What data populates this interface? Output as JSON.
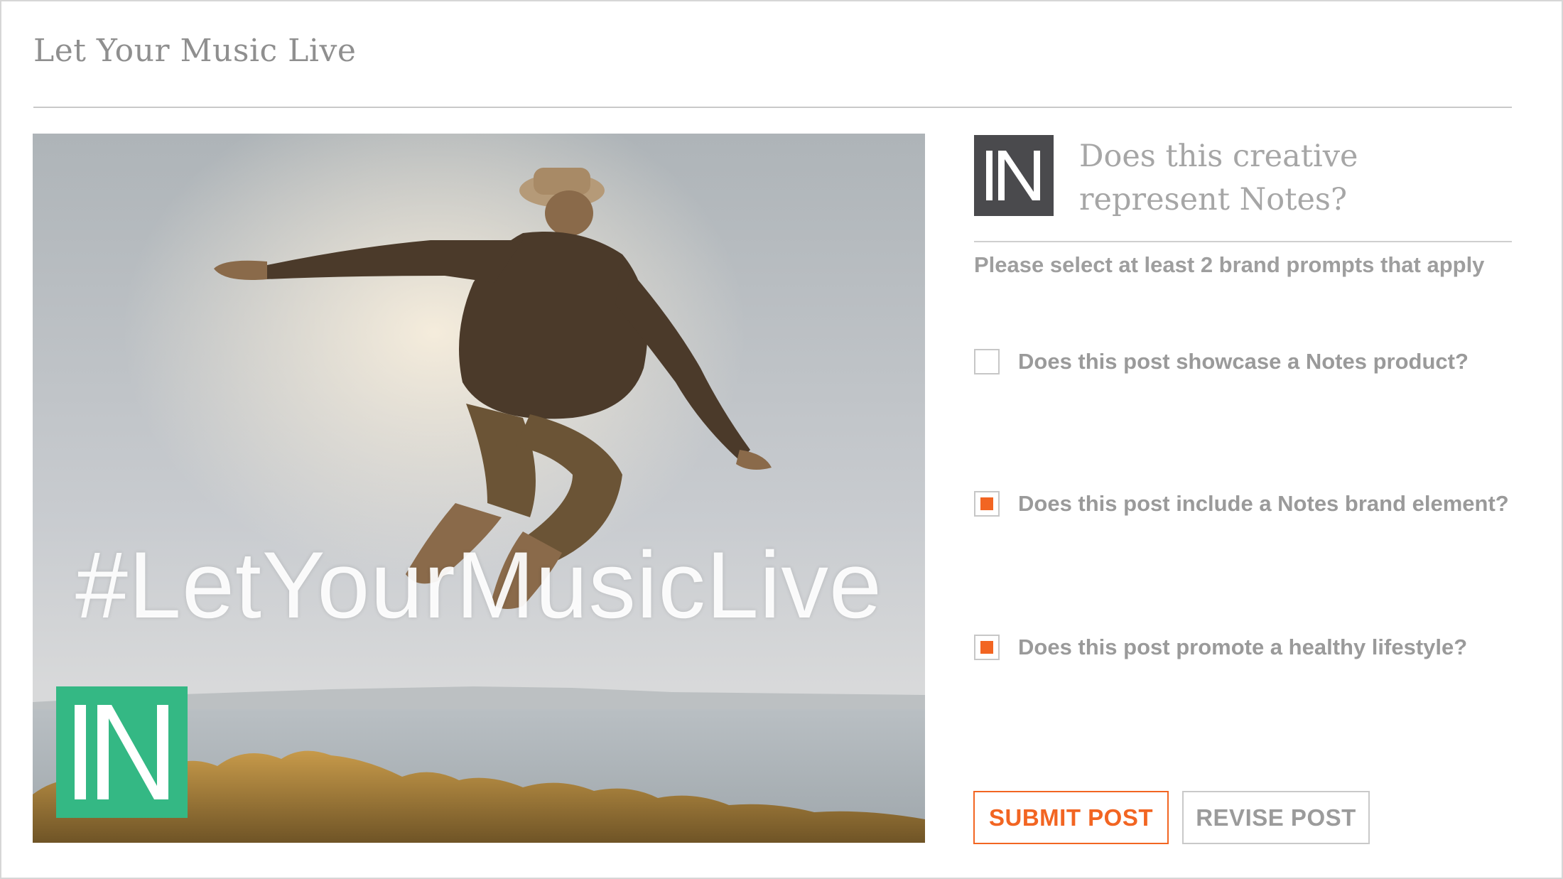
{
  "page": {
    "title": "Let Your Music Live"
  },
  "creative": {
    "hashtag": "#LetYourMusicLive",
    "logo_icon": "notes-n-logo",
    "logo_color": "#34b884"
  },
  "review_panel": {
    "brand_icon": "notes-n-logo",
    "brand_tile_color": "#4a4a4d",
    "question_line1": "Does this creative",
    "question_line2": "represent Notes?",
    "instructions": "Please select at least 2 brand prompts that apply",
    "options": [
      {
        "label": "Does this post showcase a Notes product?",
        "checked": false
      },
      {
        "label": "Does this post include a Notes brand element?",
        "checked": true
      },
      {
        "label": "Does this post promote a healthy lifestyle?",
        "checked": true
      }
    ],
    "submit_label": "SUBMIT POST",
    "revise_label": "REVISE POST"
  },
  "colors": {
    "accent": "#f26522",
    "brand_green": "#34b884",
    "text_muted": "#9a9a9a"
  }
}
